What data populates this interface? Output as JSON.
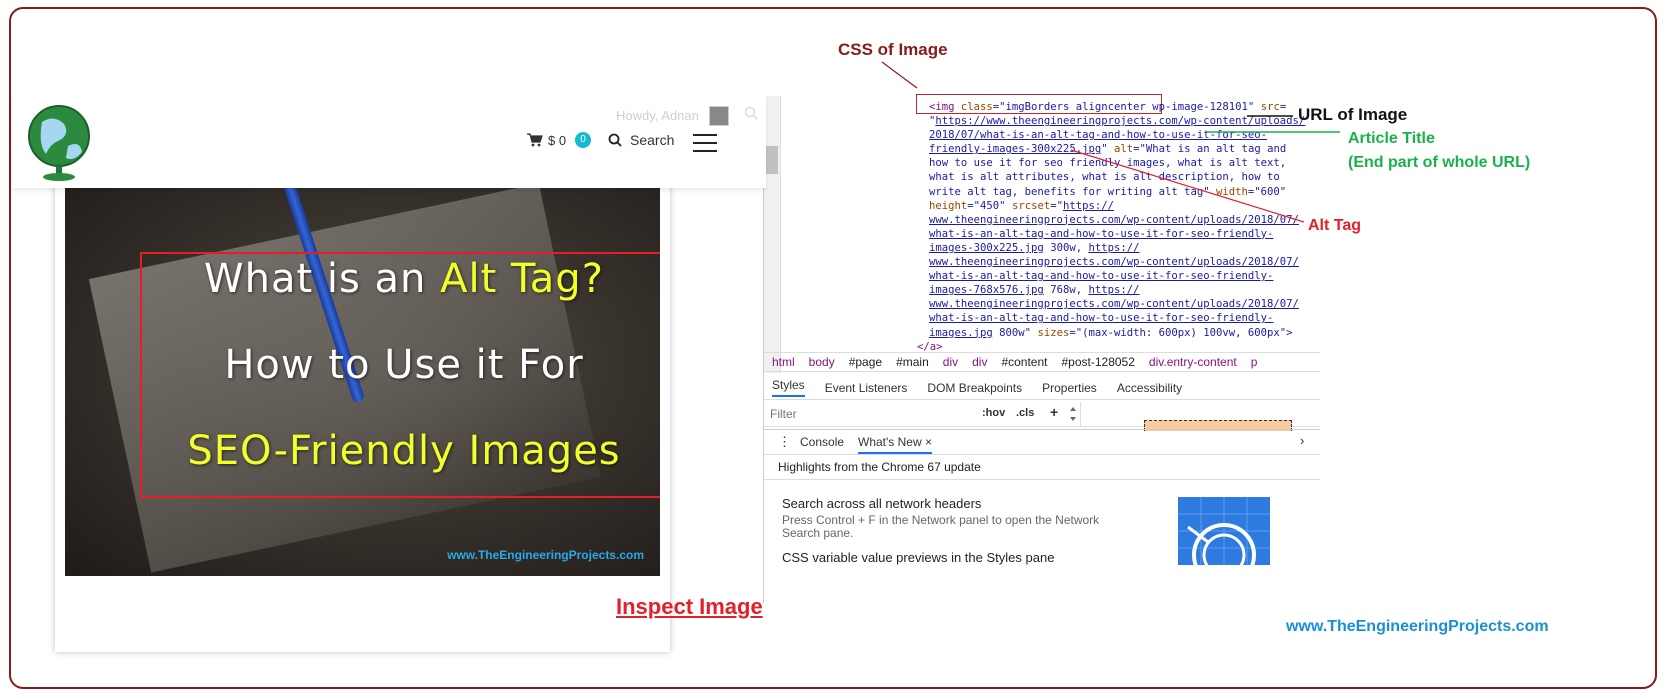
{
  "annotations": {
    "css_label": "CSS of Image",
    "url_label": "URL of Image",
    "title_label_line1": "Article Title",
    "title_label_line2": "(End part of whole URL)",
    "alt_label": "Alt Tag",
    "caption": "Inspect Image",
    "site_footer": "www.TheEngineeringProjects.com",
    "colors": {
      "css": "#8b1a1a",
      "url": "#111111",
      "title": "#19b24a",
      "alt": "#e2202a",
      "caption": "#e2202a",
      "footer": "#1a8fd6"
    }
  },
  "website": {
    "howdy": "Howdy, Adnan",
    "cart_amount": "$ 0",
    "cart_count": "0",
    "search_label": "Search",
    "hero": {
      "line1_a": "What is an ",
      "line1_b": "Alt Tag?",
      "line2": "How to Use it For",
      "line3": "SEO-Friendly Images",
      "site": "www.TheEngineeringProjects.com"
    }
  },
  "devtools": {
    "code": {
      "l1_open": "<img ",
      "l1_attr_class": "class",
      "l1_eq1": "=\"",
      "l1_class_val": "imgBorders aligncenter wp-image-128101",
      "l1_q1": "\" ",
      "l1_attr_src": "src",
      "l1_eq2": "=",
      "l2_q": "\"",
      "l2_url": "https://www.theengineeringprojects.com/wp-content/uploads/",
      "l3_url": "2018/07/what-is-an-alt-tag-and-how-to-use-it-for-seo-",
      "l4_url": "friendly-images-300x225.jpg",
      "l4_q": "\" ",
      "l4_attr_alt": "alt",
      "l4_eq": "=\"",
      "l4_alt": "What is an alt tag and",
      "l5_alt": "how to use it for seo friendly images, what is alt text,",
      "l6_alt": "what is alt attributes, what is alt description, how to",
      "l7_alt": "write alt tag, benefits for writing alt tag",
      "l7_q": "\" ",
      "l7_attr_width": "width",
      "l7_width": "=\"600\"",
      "l8_attr_height": "height",
      "l8_height": "=\"450\" ",
      "l8_attr_srcset": "srcset",
      "l8_eq": "=\"",
      "l8_url": "https://",
      "l9_url": "www.theengineeringprojects.com/wp-content/uploads/2018/07/",
      "l10_url": "what-is-an-alt-tag-and-how-to-use-it-for-seo-friendly-",
      "l11_url": "images-300x225.jpg",
      "l11_txt": " 300w, ",
      "l11_url2": "https://",
      "l12_url": "www.theengineeringprojects.com/wp-content/uploads/2018/07/",
      "l13_url": "what-is-an-alt-tag-and-how-to-use-it-for-seo-friendly-",
      "l14_url": "images-768x576.jpg",
      "l14_txt": " 768w, ",
      "l14_url2": "https://",
      "l15_url": "www.theengineeringprojects.com/wp-content/uploads/2018/07/",
      "l16_url": "what-is-an-alt-tag-and-how-to-use-it-for-seo-friendly-",
      "l17_url": "images.jpg",
      "l17_txt": " 800w\" ",
      "l17_attr_sizes": "sizes",
      "l17_sizes": "=\"(max-width: 600px) 100vw, 600px\">",
      "l18_close": "</a>"
    },
    "breadcrumbs": [
      "html",
      "body",
      "#page",
      "#main",
      "div",
      "div",
      "#content",
      "#post-128052",
      "div.entry-content",
      "p"
    ],
    "tabs": [
      "Styles",
      "Event Listeners",
      "DOM Breakpoints",
      "Properties",
      "Accessibility"
    ],
    "filter_placeholder": "Filter",
    "hov": ":hov",
    "cls": ".cls",
    "plus": "+",
    "drawer": {
      "console": "Console",
      "whats_new": "What's New",
      "close": "×"
    },
    "highlights": "Highlights from the Chrome 67 update",
    "news": [
      {
        "title": "Search across all network headers",
        "desc": "Press Control + F in the Network panel to open the Network Search pane."
      },
      {
        "title": "CSS variable value previews in the Styles pane",
        "desc": ""
      }
    ]
  }
}
